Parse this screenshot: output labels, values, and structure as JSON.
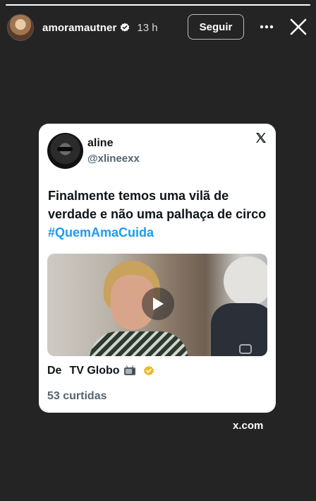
{
  "story": {
    "progress": 1.0,
    "username": "amoramautner",
    "verified": true,
    "timestamp": "13 h",
    "follow_label": "Seguir",
    "more_icon": "more-horizontal-icon",
    "close_icon": "close-icon",
    "link_domain": "x.com"
  },
  "tweet": {
    "display_name": "aline",
    "handle": "@xlineexx",
    "text_before": "Finalmente temos uma vilã de verdade e não uma palhaça de circo ",
    "hashtag": "#QuemAmaCuida",
    "source_prefix": "De",
    "source_name": "TV Globo",
    "likes": "53 curtidas",
    "media_type": "video",
    "colors": {
      "hashtag": "#1d9bf0",
      "handle": "#536471"
    }
  }
}
